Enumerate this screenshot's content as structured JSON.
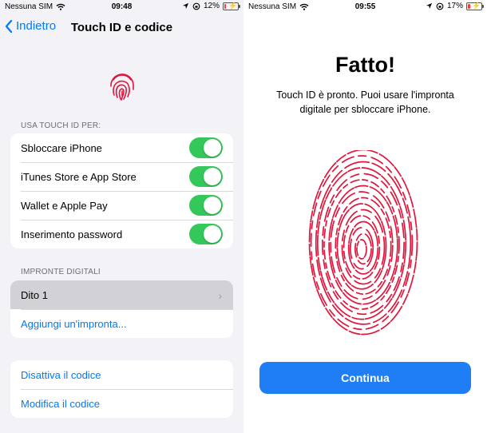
{
  "left": {
    "status": {
      "carrier": "Nessuna SIM",
      "time": "09:48",
      "battery": "12%",
      "battery_level": 0.12
    },
    "nav": {
      "back": "Indietro",
      "title": "Touch ID e codice"
    },
    "use_section": {
      "header": "USA TOUCH ID PER:",
      "items": [
        {
          "label": "Sbloccare iPhone",
          "on": true
        },
        {
          "label": "iTunes Store e App Store",
          "on": true
        },
        {
          "label": "Wallet e Apple Pay",
          "on": true
        },
        {
          "label": "Inserimento password",
          "on": true
        }
      ]
    },
    "fingerprints_section": {
      "header": "IMPRONTE DIGITALI",
      "finger": "Dito 1",
      "add": "Aggiungi un'impronta..."
    },
    "passcode": {
      "disable": "Disattiva il codice",
      "change": "Modifica il codice"
    }
  },
  "right": {
    "status": {
      "carrier": "Nessuna SIM",
      "time": "09:55",
      "battery": "17%",
      "battery_level": 0.17
    },
    "title": "Fatto!",
    "desc_line1": "Touch ID è pronto. Puoi usare l'impronta",
    "desc_line2": "digitale per sbloccare iPhone.",
    "continue": "Continua"
  },
  "colors": {
    "accent": "#007aff",
    "toggle_on": "#34c759",
    "fingerprint": "#e0163c",
    "button": "#1f7ef6"
  }
}
